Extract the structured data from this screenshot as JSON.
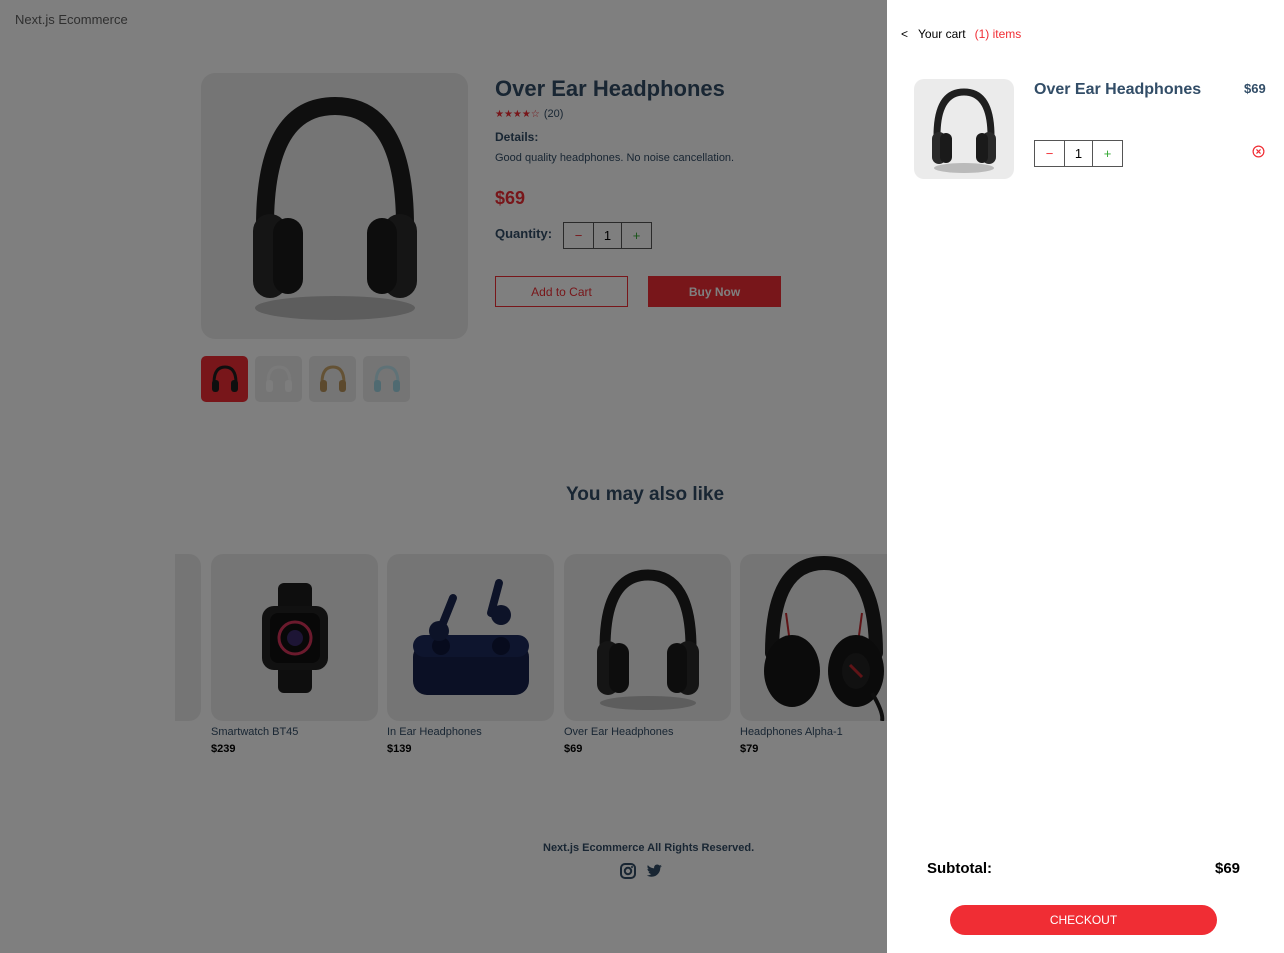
{
  "header": {
    "logo": "Next.js Ecommerce"
  },
  "product": {
    "title": "Over Ear Headphones",
    "stars": "★★★★☆",
    "reviews": "(20)",
    "details_label": "Details:",
    "description": "Good quality headphones. No noise cancellation.",
    "price": "$69",
    "quantity_label": "Quantity:",
    "qty": {
      "minus": "−",
      "value": "1",
      "plus": "+"
    },
    "add_to_cart": "Add to Cart",
    "buy_now": "Buy Now",
    "thumb_colors": [
      "black",
      "white",
      "beige",
      "light-blue"
    ]
  },
  "also_like": {
    "title": "You may also like",
    "items": [
      {
        "name": "Smartwatch BT45",
        "price": "$239"
      },
      {
        "name": "In Ear Headphones",
        "price": "$139"
      },
      {
        "name": "Over Ear Headphones",
        "price": "$69"
      },
      {
        "name": "Headphones Alpha-1",
        "price": "$79"
      }
    ]
  },
  "footer": {
    "text": "Next.js Ecommerce All Rights Reserved.",
    "icons": [
      "instagram-icon",
      "twitter-icon"
    ]
  },
  "cart": {
    "back_icon": "<",
    "label": "Your cart",
    "count": "(1) items",
    "item": {
      "title": "Over Ear Headphones",
      "price": "$69",
      "qty": {
        "minus": "−",
        "value": "1",
        "plus": "+"
      }
    },
    "subtotal_label": "Subtotal:",
    "subtotal_value": "$69",
    "checkout": "CHECKOUT"
  },
  "colors": {
    "accent": "#f02d34",
    "text": "#324d67",
    "card_bg": "#ebebeb"
  }
}
